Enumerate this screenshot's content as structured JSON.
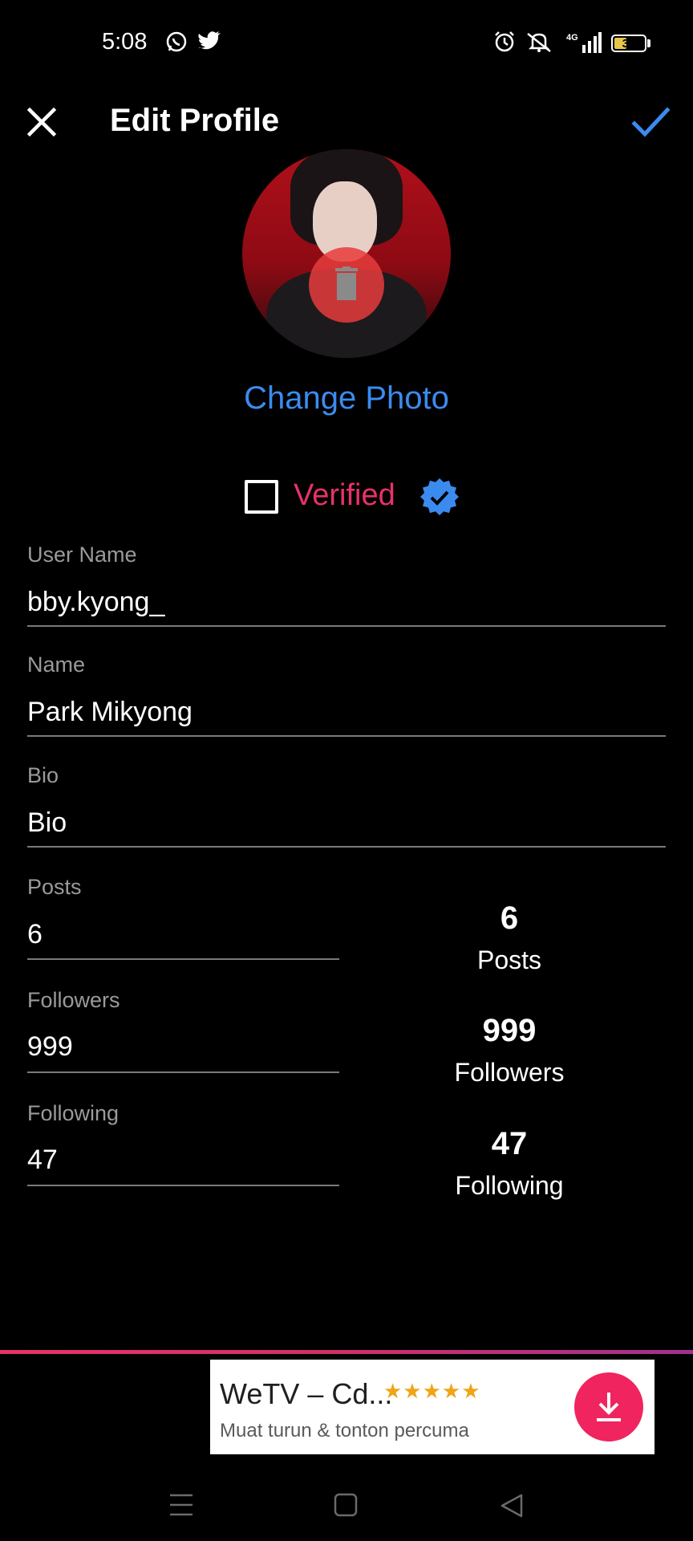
{
  "status_bar": {
    "time": "5:08",
    "battery_level": "37",
    "icons": [
      "whatsapp-icon",
      "twitter-icon",
      "alarm-icon",
      "mute-icon",
      "4g-signal-icon",
      "battery-icon"
    ]
  },
  "toolbar": {
    "title": "Edit Profile",
    "close_icon": "close-icon",
    "save_icon": "check-icon",
    "accent_color": "#3b8bef"
  },
  "avatar": {
    "delete_icon": "trash-icon",
    "change_photo_label": "Change Photo"
  },
  "verified": {
    "label": "Verified",
    "checked": false,
    "label_color": "#e8326a",
    "badge_icon": "verified-badge-icon",
    "badge_color": "#3b8bef"
  },
  "fields": {
    "username": {
      "label": "User Name",
      "value": "bby.kyong_"
    },
    "name": {
      "label": "Name",
      "value": "Park Mikyong"
    },
    "bio": {
      "label": "Bio",
      "value": "",
      "placeholder": "Bio"
    },
    "posts": {
      "label": "Posts",
      "value": "6"
    },
    "followers": {
      "label": "Followers",
      "value": "999"
    },
    "following": {
      "label": "Following",
      "value": "47"
    }
  },
  "stats": {
    "posts": {
      "value": "6",
      "label": "Posts"
    },
    "followers": {
      "value": "999",
      "label": "Followers"
    },
    "following": {
      "value": "47",
      "label": "Following"
    }
  },
  "ad": {
    "title": "WeTV – Cd...",
    "rating_stars": "★★★★★",
    "rating": 4.5,
    "subtitle": "Muat turun & tonton percuma",
    "install_icon": "download-icon",
    "install_color": "#f0245e"
  },
  "nav_bar": {
    "icons": [
      "menu-icon",
      "home-icon",
      "back-icon"
    ]
  }
}
